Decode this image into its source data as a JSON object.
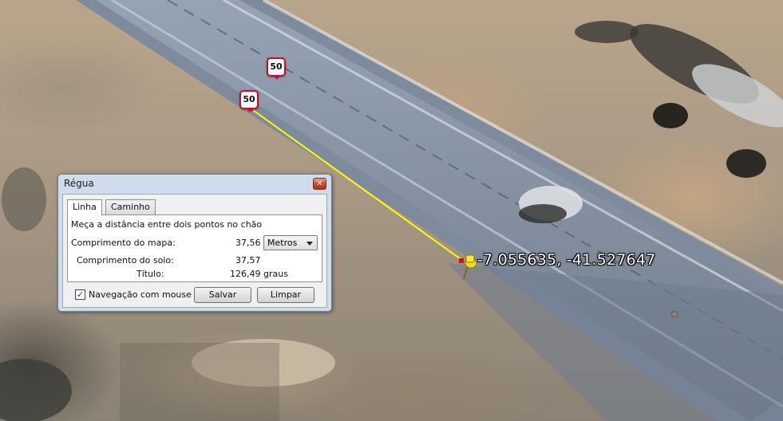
{
  "map": {
    "speed_signs": [
      "50",
      "50"
    ],
    "coordinate_label": "-7.055635, -41.527647",
    "colors": {
      "measure_line": "#ffff00",
      "road": "#8a99ad"
    },
    "icons": [
      "speed-limit-sign-icon",
      "yellow-pushpin-icon",
      "placemark-icon"
    ]
  },
  "dialog": {
    "title": "Régua",
    "close_icon": "close-icon",
    "tabs": [
      {
        "label": "Linha",
        "selected": true
      },
      {
        "label": "Caminho",
        "selected": false
      }
    ],
    "description": "Meça a distância entre dois pontos no chão",
    "rows": {
      "map_length_label": "Comprimento do mapa:",
      "map_length_value": "37,56",
      "unit": "Metros",
      "ground_length_label": "Comprimento do solo:",
      "ground_length_value": "37,57",
      "heading_label": "Título:",
      "heading_value": "126,49 graus"
    },
    "mouse_nav": {
      "label": "Navegação com mouse",
      "checked": true,
      "check_mark": "✓"
    },
    "buttons": {
      "save": "Salvar",
      "clear": "Limpar"
    }
  }
}
